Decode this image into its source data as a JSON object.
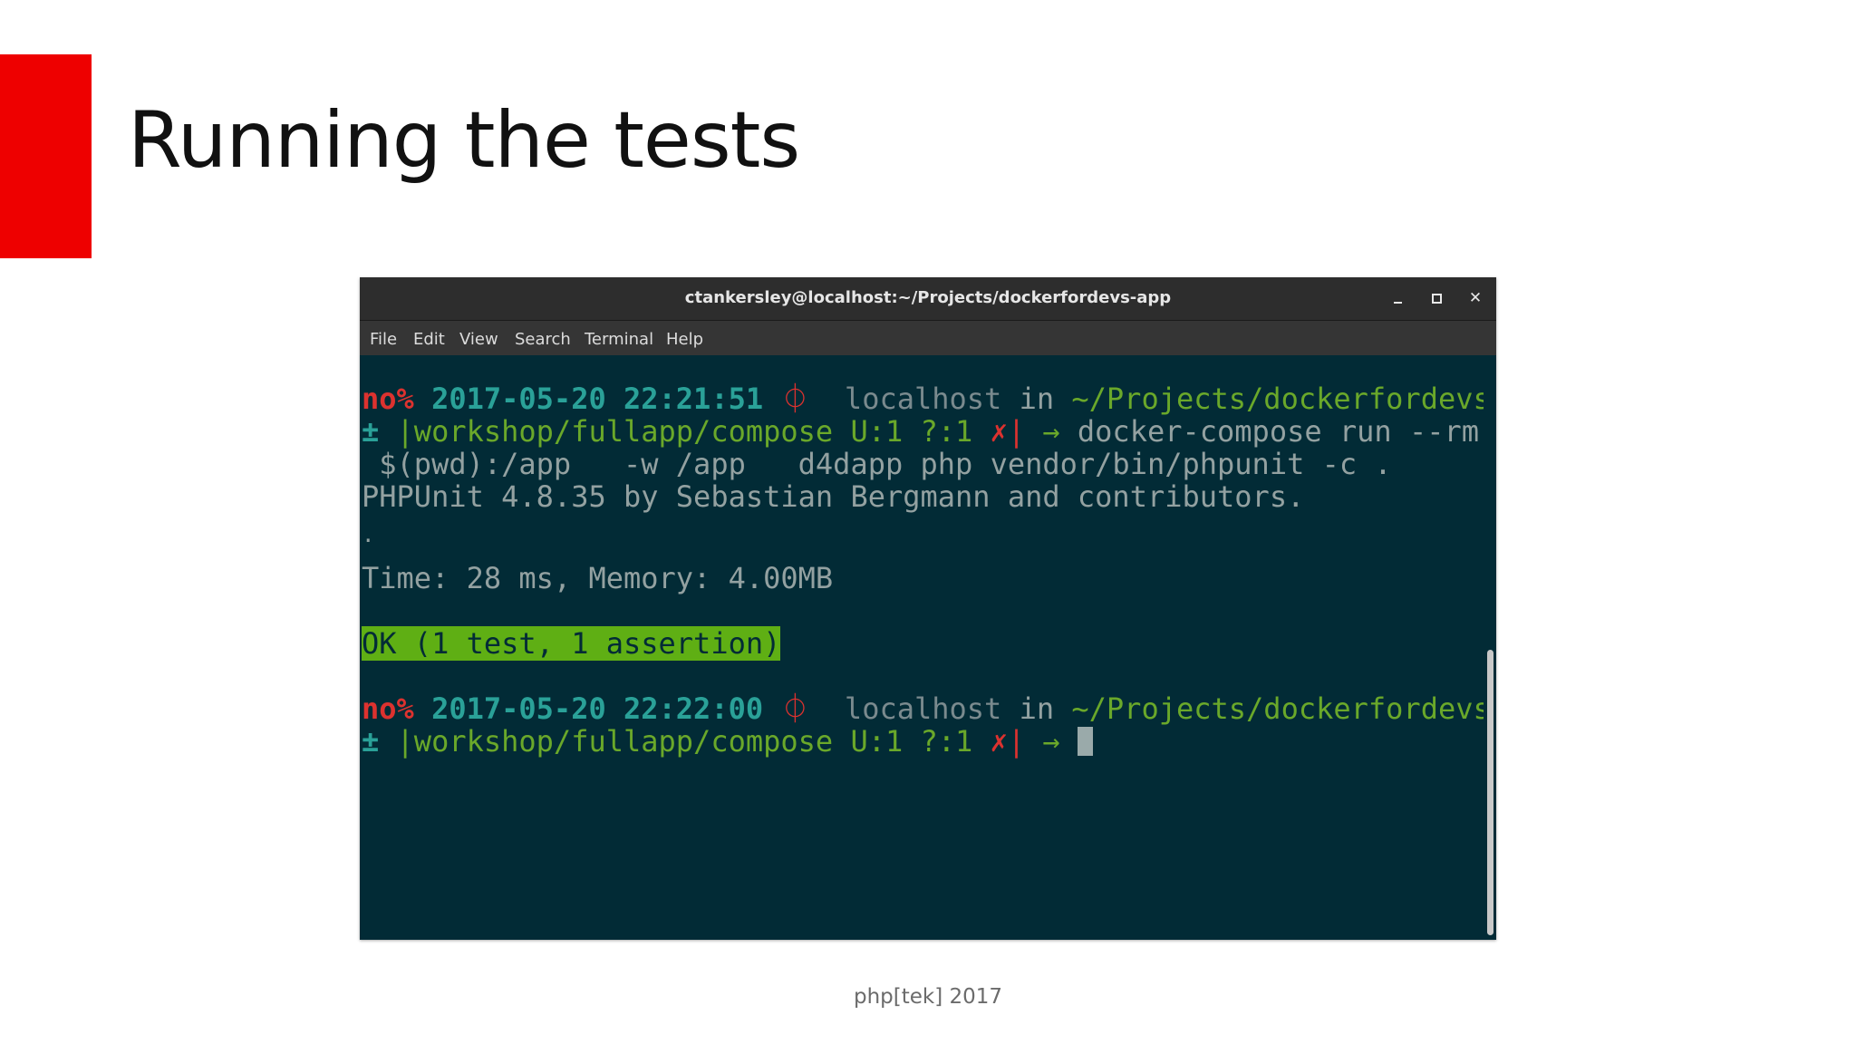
{
  "slide": {
    "title": "Running the tests",
    "footer": "php[tek] 2017",
    "accent_color": "#ee0000"
  },
  "window": {
    "title": "ctankersley@localhost:~/Projects/dockerfordevs-app",
    "buttons": {
      "minimize": "minimize-icon",
      "maximize": "maximize-icon",
      "close": "close-icon"
    },
    "menu": [
      "File",
      "Edit",
      "View",
      "Search",
      "Terminal",
      "Help"
    ]
  },
  "terminal": {
    "background_color": "#022b36",
    "prompt1": {
      "status": "no%",
      "datetime": "2017-05-20 22:21:51",
      "symbol": "⏀",
      "host": "localhost",
      "in": "in",
      "path": "~/Projects/dockerfordevs-app",
      "plusminus": "±",
      "branch": "|workshop/fullapp/compose",
      "git_status": "U:1 ?:1",
      "cross": "✗|",
      "arrow": "→",
      "command": "docker-compose run --rm   -v"
    },
    "command_cont": " $(pwd):/app   -w /app   d4dapp php vendor/bin/phpunit -c .",
    "phpunit_header": "PHPUnit 4.8.35 by Sebastian Bergmann and contributors.",
    "progress": ".",
    "time_line": "Time: 28 ms, Memory: 4.00MB",
    "ok_line": "OK (1 test, 1 assertion)",
    "prompt2": {
      "status": "no%",
      "datetime": "2017-05-20 22:22:00",
      "symbol": "⏀",
      "host": "localhost",
      "in": "in",
      "path": "~/Projects/dockerfordevs-app",
      "plusminus": "±",
      "branch": "|workshop/fullapp/compose",
      "git_status": "U:1 ?:1",
      "cross": "✗|",
      "arrow": "→"
    }
  }
}
